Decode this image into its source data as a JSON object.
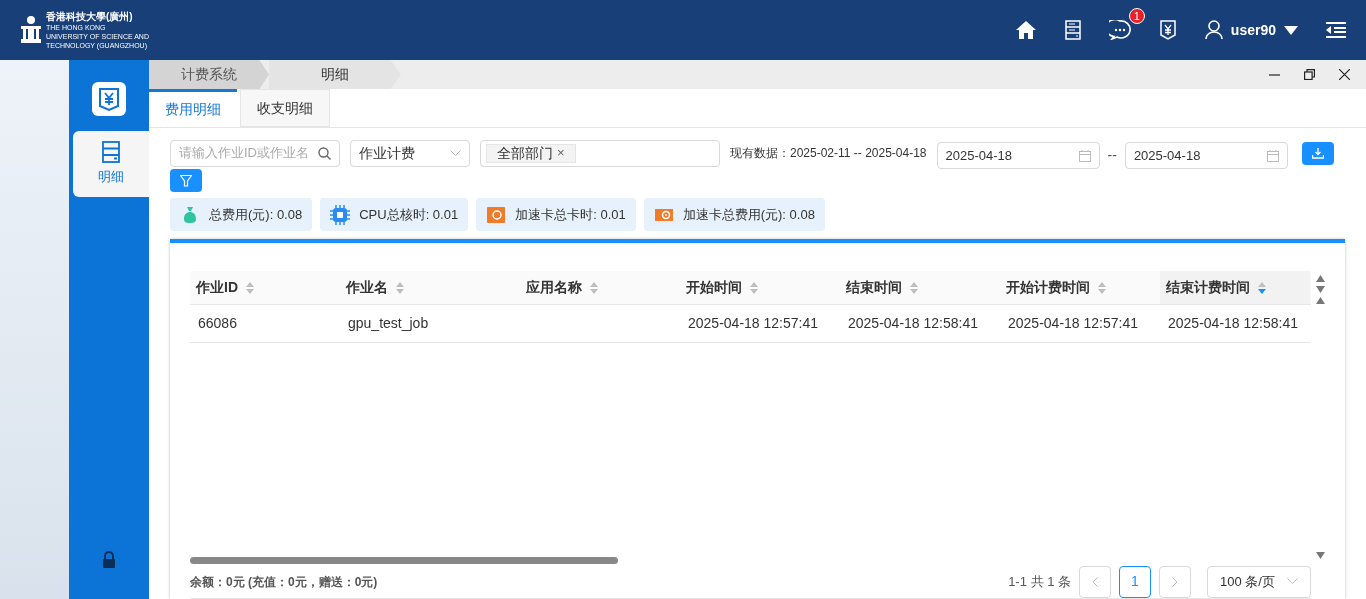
{
  "header": {
    "logo_lines": [
      "香港科技大學(廣州)",
      "THE HONG KONG",
      "UNIVERSITY OF SCIENCE AND",
      "TECHNOLOGY (GUANGZHOU)"
    ],
    "badge": "1",
    "username": "user90"
  },
  "sidebar": {
    "items": [
      {
        "label": "明细",
        "selected": true
      }
    ]
  },
  "breadcrumbs": [
    {
      "label": "计费系统",
      "selected": false
    },
    {
      "label": "明细",
      "selected": true
    }
  ],
  "tabs": [
    {
      "label": "费用明细",
      "selected": true
    },
    {
      "label": "收支明细",
      "selected": false
    }
  ],
  "filters": {
    "search_placeholder": "请输入作业ID或作业名",
    "select_value": "作业计费",
    "tag": "全部部门",
    "tag_close": "×",
    "data_range": "现有数据：2025-02-11 -- 2025-04-18",
    "date_from": "2025-04-18",
    "separator": "--",
    "date_to": "2025-04-18"
  },
  "stats": [
    {
      "kind": "money",
      "label": "总费用(元): 0.08"
    },
    {
      "kind": "cpu",
      "label": "CPU总核时: 0.01"
    },
    {
      "kind": "card",
      "label": "加速卡总卡时: 0.01"
    },
    {
      "kind": "card_cost",
      "label": "加速卡总费用(元): 0.08"
    }
  ],
  "table": {
    "columns": [
      {
        "label": "作业ID",
        "sorted": false
      },
      {
        "label": "作业名",
        "sorted": false
      },
      {
        "label": "应用名称",
        "sorted": false
      },
      {
        "label": "开始时间",
        "sorted": false
      },
      {
        "label": "结束时间",
        "sorted": false
      },
      {
        "label": "开始计费时间",
        "sorted": false
      },
      {
        "label": "结束计费时间",
        "sorted": true
      }
    ],
    "rows": [
      [
        "66086",
        "gpu_test_job",
        "",
        "2025-04-18 12:57:41",
        "2025-04-18 12:58:41",
        "2025-04-18 12:57:41",
        "2025-04-18 12:58:41"
      ]
    ]
  },
  "footer": {
    "balance": "余额：0元 (充值：0元，赠送：0元)",
    "total": "1-1 共 1 条",
    "pages": [
      {
        "label": "1",
        "selected": true
      }
    ],
    "page_size": "100 条/页"
  }
}
